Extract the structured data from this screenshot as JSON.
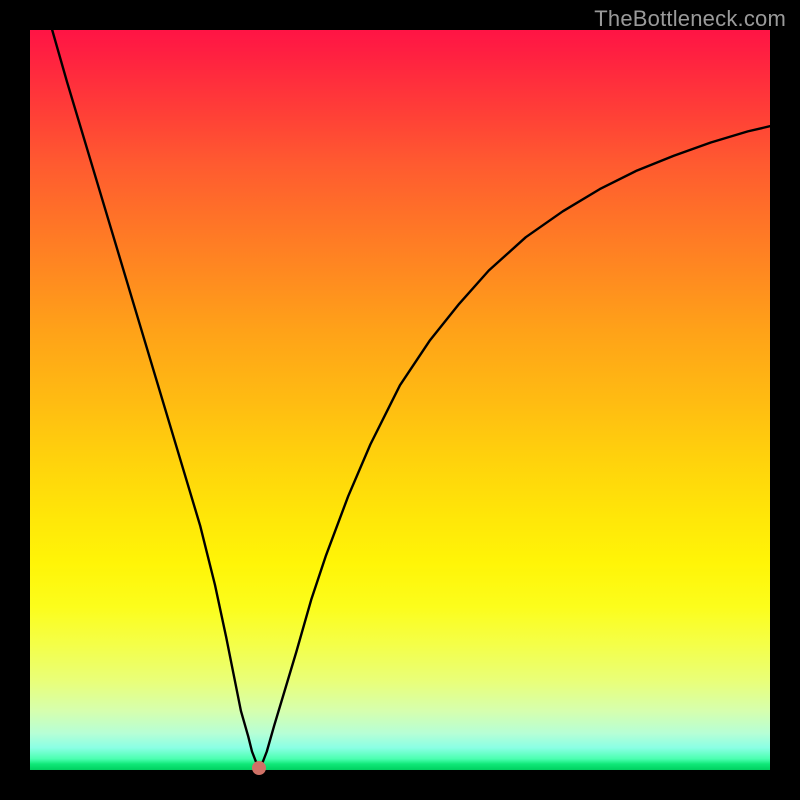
{
  "watermark": "TheBottleneck.com",
  "chart_data": {
    "type": "line",
    "title": "",
    "xlabel": "",
    "ylabel": "",
    "xlim": [
      0,
      100
    ],
    "ylim": [
      0,
      100
    ],
    "grid": false,
    "legend": false,
    "series": [
      {
        "name": "curve",
        "x": [
          3,
          5,
          8,
          11,
          14,
          17,
          20,
          23,
          25,
          26.5,
          27.5,
          28.5,
          29.5,
          30,
          30.5,
          31,
          31.5,
          32,
          33,
          34.5,
          36,
          38,
          40,
          43,
          46,
          50,
          54,
          58,
          62,
          67,
          72,
          77,
          82,
          87,
          92,
          97,
          100
        ],
        "y": [
          100,
          93,
          83,
          73,
          63,
          53,
          43,
          33,
          25,
          18,
          13,
          8,
          4.5,
          2.5,
          1.2,
          0.3,
          1.2,
          2.5,
          6,
          11,
          16,
          23,
          29,
          37,
          44,
          52,
          58,
          63,
          67.5,
          72,
          75.5,
          78.5,
          81,
          83,
          84.8,
          86.3,
          87
        ]
      }
    ],
    "marker": {
      "name": "dot",
      "x": 31,
      "y": 0.3,
      "color": "#cf7166"
    },
    "background_gradient": {
      "direction": "vertical",
      "stops": [
        {
          "pos": 0.0,
          "color": "#ff1445"
        },
        {
          "pos": 0.5,
          "color": "#ffbb12"
        },
        {
          "pos": 0.78,
          "color": "#fcfd1c"
        },
        {
          "pos": 1.0,
          "color": "#00d060"
        }
      ]
    }
  },
  "dot": {
    "left_pct": 31,
    "top_pct": 99.7
  }
}
